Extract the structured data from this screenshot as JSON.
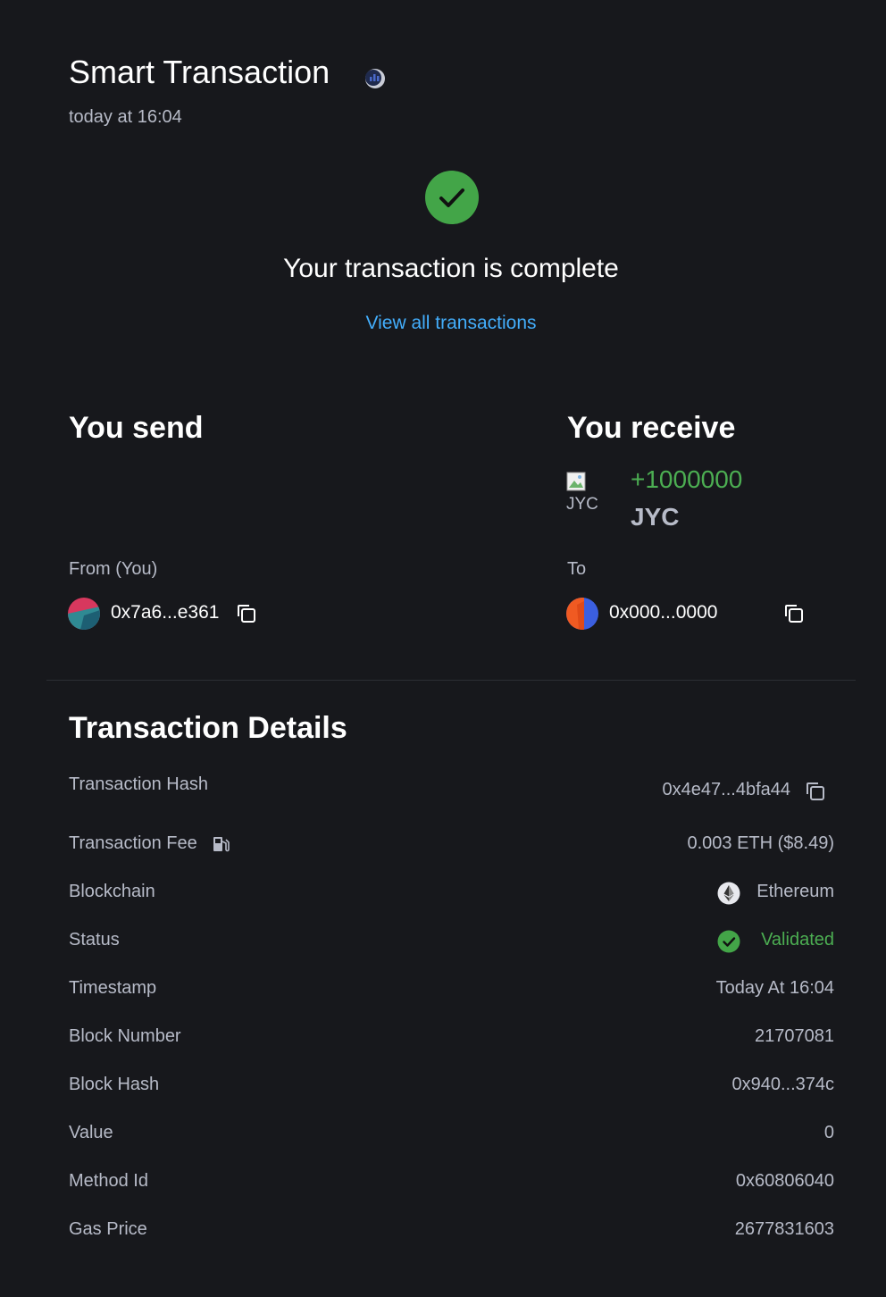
{
  "header": {
    "title": "Smart Transaction",
    "subtitle": "today at 16:04"
  },
  "status_banner": {
    "message": "Your transaction is complete",
    "link_label": "View all transactions"
  },
  "send": {
    "title": "You send",
    "from_label": "From (You)",
    "from_address": "0x7a6...e361"
  },
  "receive": {
    "title": "You receive",
    "token_image_alt": "JYC",
    "amount": "+1000000",
    "symbol": "JYC",
    "to_label": "To",
    "to_address": "0x000...0000"
  },
  "details": {
    "title": "Transaction Details",
    "rows": [
      {
        "label": "Transaction Hash",
        "value": "0x4e47...4bfa44"
      },
      {
        "label": "Transaction Fee",
        "value": "0.003 ETH ($8.49)"
      },
      {
        "label": "Blockchain",
        "value": "Ethereum"
      },
      {
        "label": "Status",
        "value": "Validated"
      },
      {
        "label": "Timestamp",
        "value": "Today At 16:04"
      },
      {
        "label": "Block Number",
        "value": "21707081"
      },
      {
        "label": "Block Hash",
        "value": "0x940...374c"
      },
      {
        "label": "Value",
        "value": "0"
      },
      {
        "label": "Method Id",
        "value": "0x60806040"
      },
      {
        "label": "Gas Price",
        "value": "2677831603"
      }
    ]
  },
  "icons": {
    "network": "network-icon",
    "success": "check-circle-icon",
    "copy": "copy-icon",
    "gas": "gas-pump-icon",
    "blockchain": "ethereum-icon",
    "validated": "check-circle-small-icon"
  },
  "colors": {
    "background": "#17181c",
    "accent_link": "#43aefc",
    "success": "#4cae52",
    "muted_text": "#b7bbc8"
  }
}
